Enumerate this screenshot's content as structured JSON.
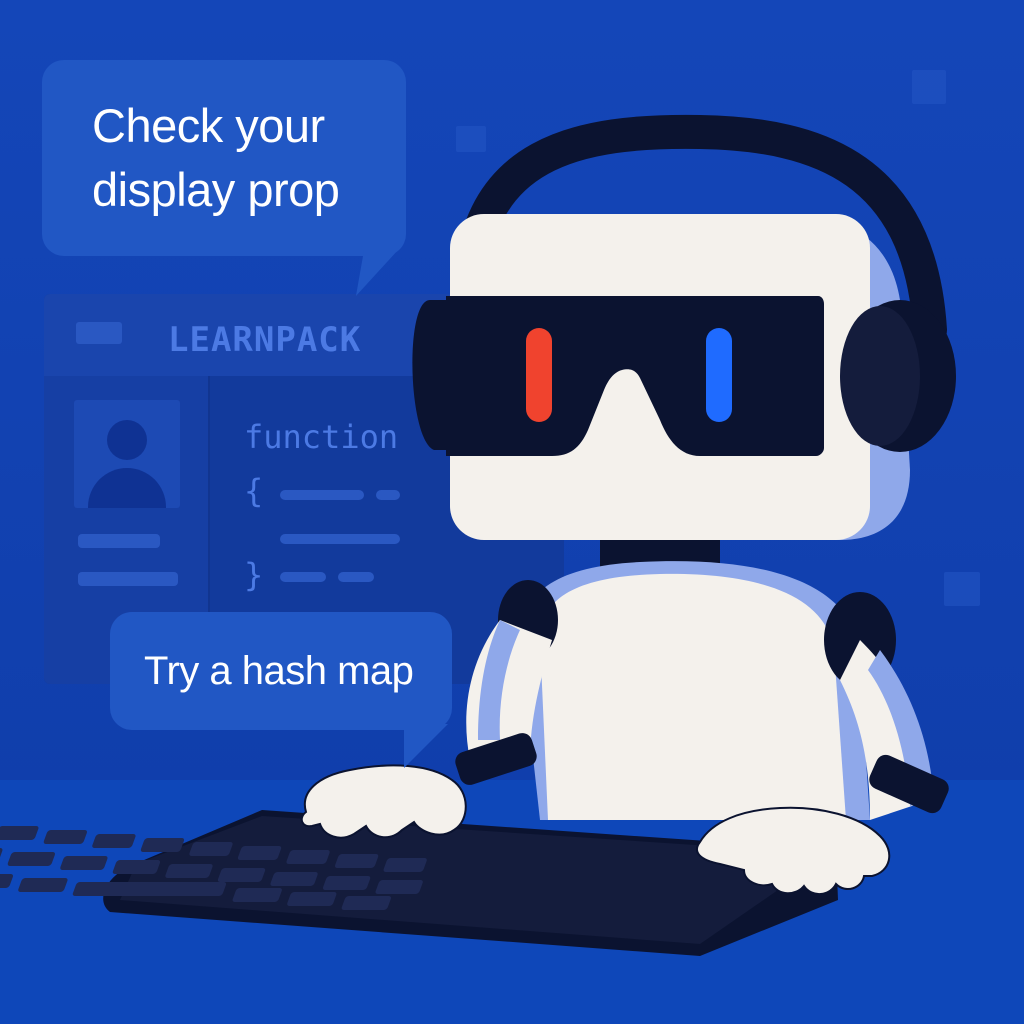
{
  "bubbles": {
    "top": {
      "line1": "Check your",
      "line2": "display prop"
    },
    "bottom": {
      "text": "Try a hash map"
    }
  },
  "background_window": {
    "brand": "LEARNPACK",
    "code_keyword": "function",
    "open_brace": "{",
    "close_brace": "}"
  },
  "colors": {
    "background": "#1446b8",
    "bubble": "#2157c4",
    "robot_body": "#f4f1ec",
    "robot_shade": "#8fa8ea",
    "visor": "#0b1330",
    "left_eye": "#f0432e",
    "right_eye": "#1f6bff"
  },
  "icons": {
    "headphones": "headphones-icon",
    "avatar": "user-avatar-icon",
    "keyboard": "keyboard-icon"
  }
}
